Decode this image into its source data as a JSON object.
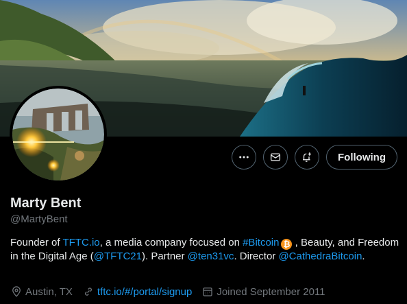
{
  "profile": {
    "name": "Marty Bent",
    "handle": "@MartyBent",
    "bio": {
      "p1": "Founder of ",
      "link1": "TFTC.io",
      "p2": ", a media company focused on ",
      "hashtag": "#Bitcoin",
      "bitcoin_glyph": "₿",
      "p3": " , Beauty, and Freedom in the Digital Age (",
      "mention1": "@TFTC21",
      "p4": "). Partner ",
      "mention2": "@ten31vc",
      "p5": ". Director ",
      "mention3": "@CathedraBitcoin",
      "p6": "."
    },
    "location": "Austin, TX",
    "website": "tftc.io/#/portal/signup",
    "joined": "Joined September 2011"
  },
  "actions": {
    "following_label": "Following"
  },
  "icons": {
    "more": "more-icon",
    "message": "envelope-icon",
    "notify": "bell-plus-icon",
    "location": "location-pin-icon",
    "link": "link-icon",
    "calendar": "calendar-icon"
  },
  "colors": {
    "accent": "#1d9bf0",
    "text": "#e7e9ea",
    "muted": "#71767b",
    "border": "#536471",
    "bitcoin": "#f7931a"
  }
}
